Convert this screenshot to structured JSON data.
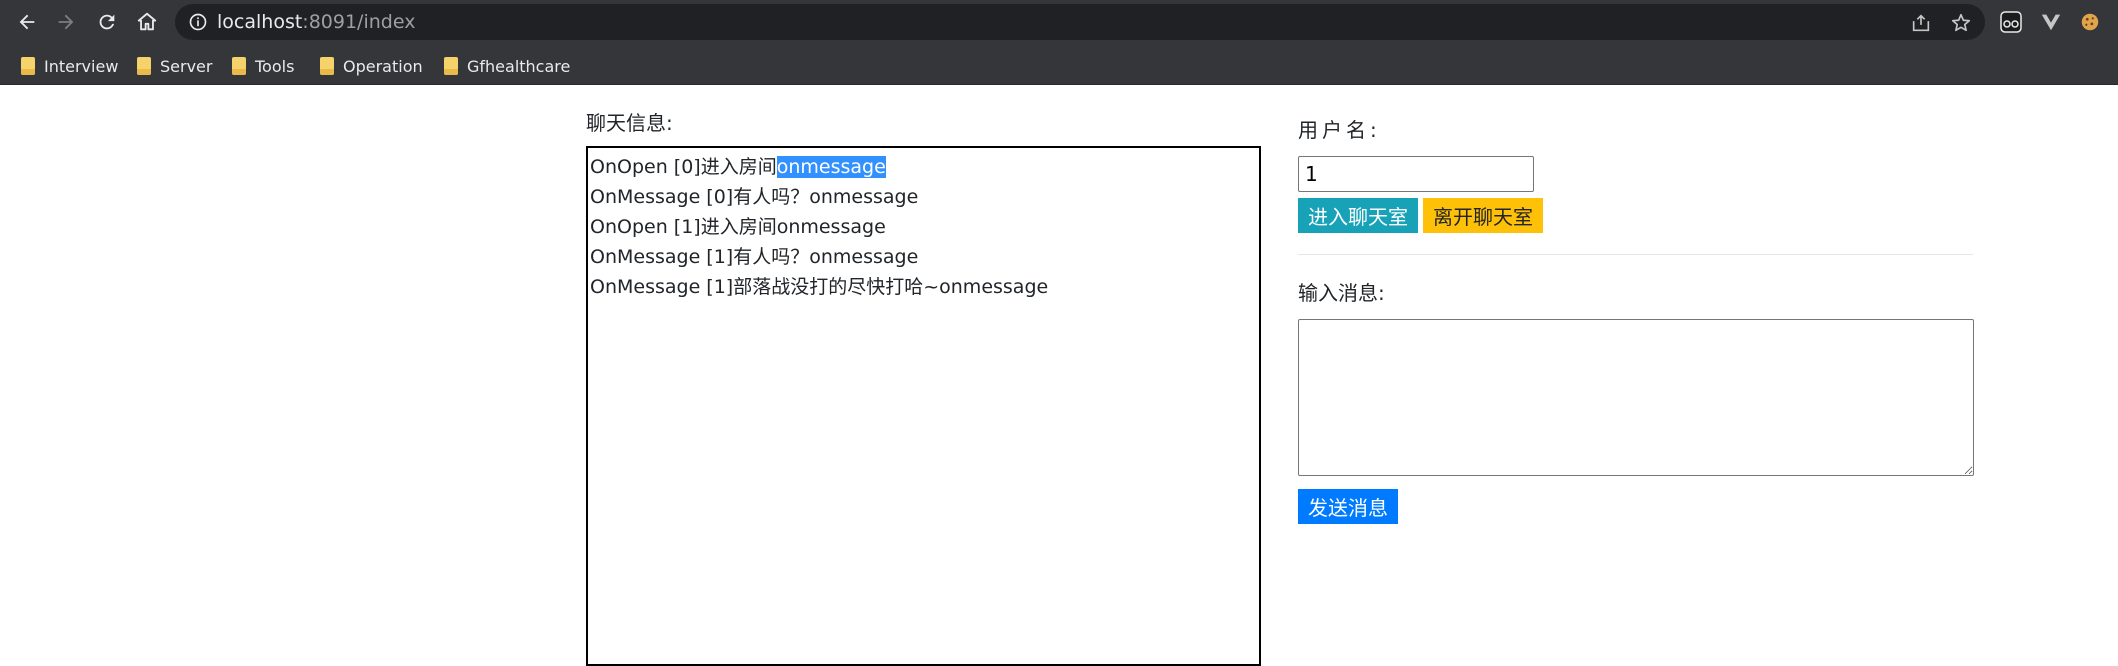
{
  "browser": {
    "url_host": "localhost",
    "url_rest": ":8091/index",
    "bookmarks": [
      {
        "label": "Interview"
      },
      {
        "label": "Server"
      },
      {
        "label": "Tools"
      },
      {
        "label": "Operation"
      },
      {
        "label": "Gfhealthcare"
      }
    ]
  },
  "chat": {
    "label": "聊天信息:",
    "messages": [
      {
        "text": "OnOpen [0]进入房间",
        "selected": "onmessage"
      },
      {
        "text": "OnMessage [0]有人吗？onmessage",
        "selected": ""
      },
      {
        "text": "OnOpen [1]进入房间onmessage",
        "selected": ""
      },
      {
        "text": "OnMessage [1]有人吗？onmessage",
        "selected": ""
      },
      {
        "text": "OnMessage [1]部落战没打的尽快打哈~onmessage",
        "selected": ""
      }
    ]
  },
  "user": {
    "label": "用户名:",
    "value": "1",
    "join_label": "进入聊天室",
    "leave_label": "离开聊天室"
  },
  "compose": {
    "label": "输入消息:",
    "value": "",
    "send_label": "发送消息"
  },
  "colors": {
    "join": "#17a2b8",
    "leave": "#ffc107",
    "send": "#007bff",
    "selection": "#3390ff"
  }
}
